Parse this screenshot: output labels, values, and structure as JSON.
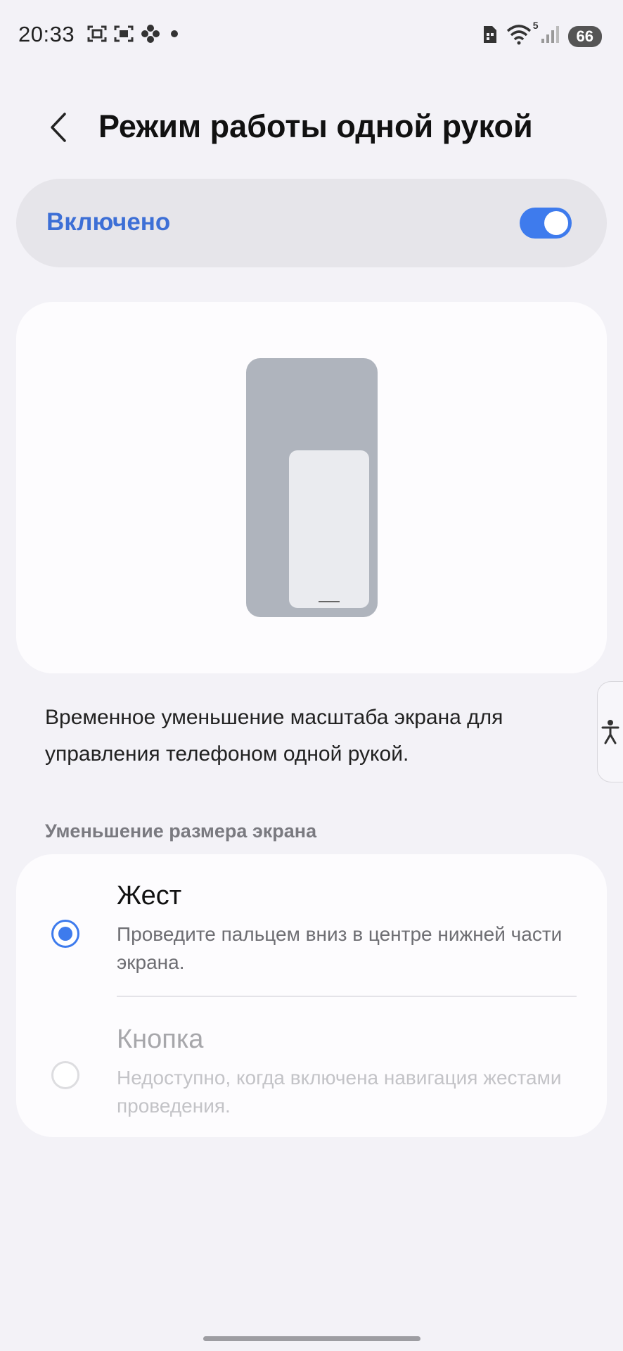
{
  "status_bar": {
    "time": "20:33",
    "left_icons": [
      "screenshot-icon",
      "screenshot-gallery-icon",
      "flower-icon",
      "dot-icon"
    ],
    "right_icons": [
      "sim-icon",
      "wifi-icon",
      "signal-icon"
    ],
    "wifi_label": "5",
    "battery": "66"
  },
  "header": {
    "back_icon": "chevron-left-icon",
    "title": "Режим работы одной рукой"
  },
  "master_switch": {
    "label": "Включено",
    "checked": true,
    "accent_color": "#3e7bed"
  },
  "description": "Временное уменьшение масштаба экрана для управления телефоном одной рукой.",
  "section_header": "Уменьшение размера экрана",
  "options": [
    {
      "title": "Жест",
      "subtitle": "Проведите пальцем вниз в центре нижней части экрана.",
      "selected": true,
      "enabled": true
    },
    {
      "title": "Кнопка",
      "subtitle": "Недоступно, когда включена навигация жестами проведения.",
      "selected": false,
      "enabled": false
    }
  ],
  "side_tab_icon": "accessibility-icon"
}
